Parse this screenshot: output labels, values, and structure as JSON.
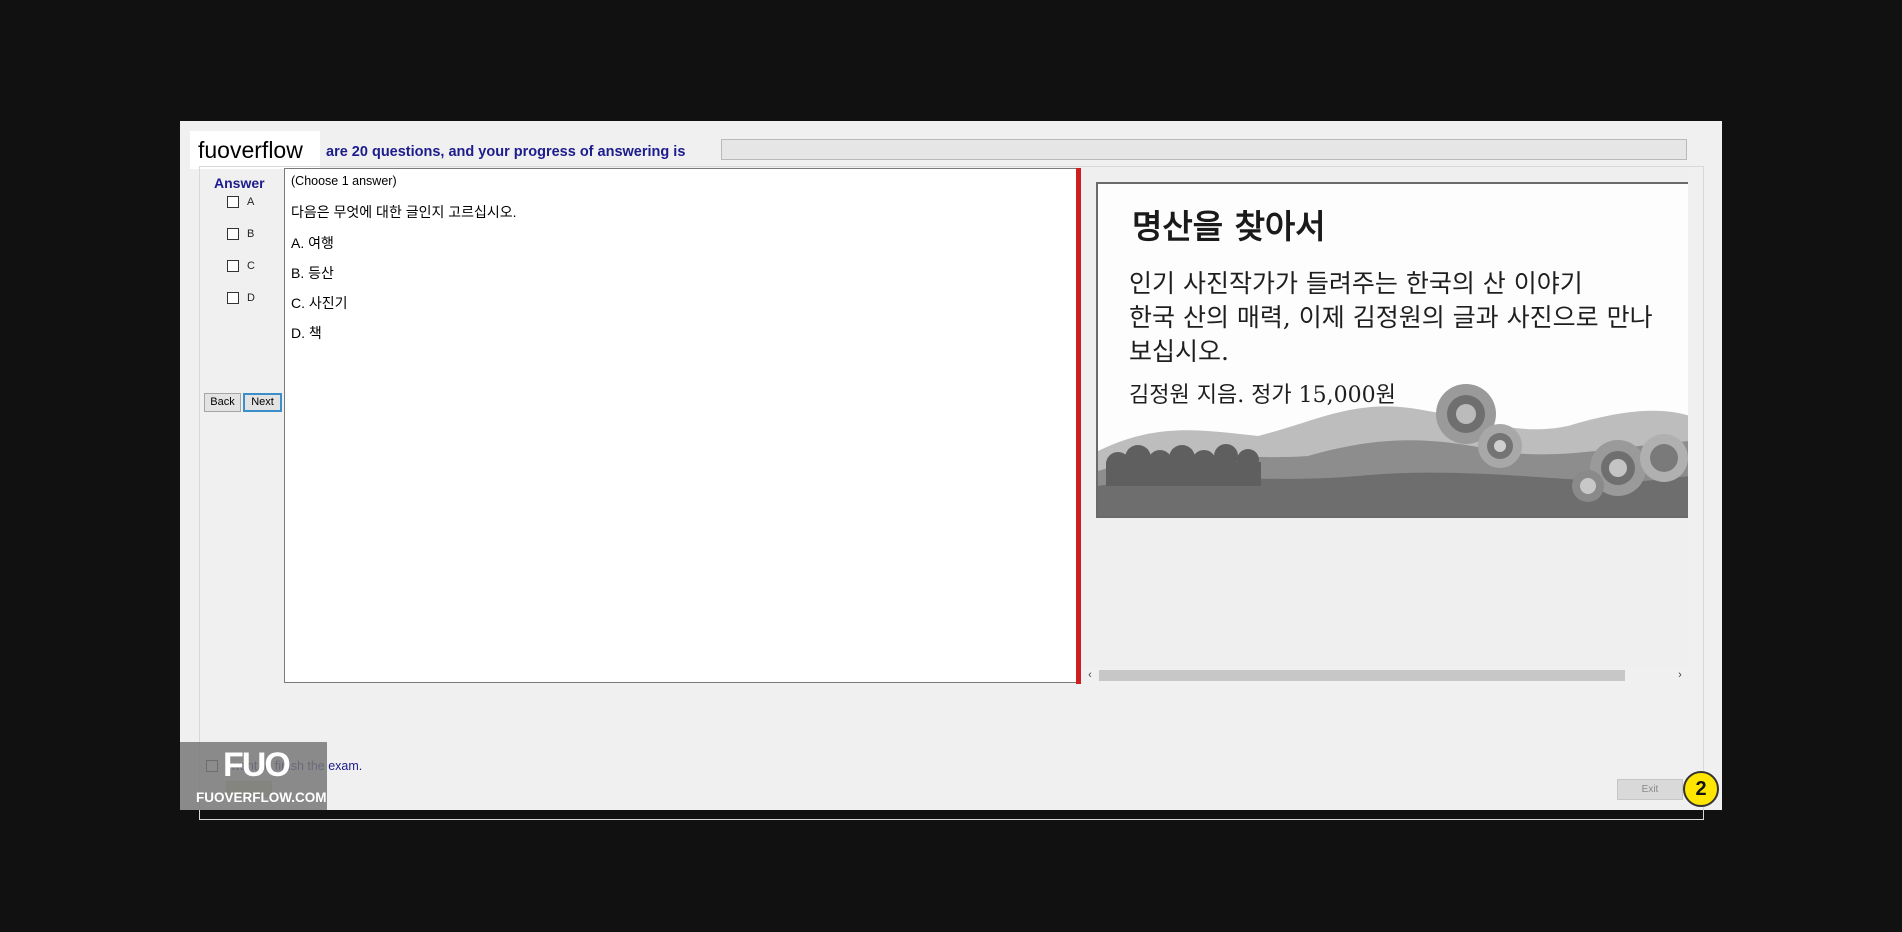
{
  "site_label": "fuoverflow",
  "header": {
    "progress_text": "are 20 questions, and your progress of answering is",
    "progress_fraction": 0
  },
  "answer_panel": {
    "title": "Answer",
    "options": [
      "A",
      "B",
      "C",
      "D"
    ],
    "back_label": "Back",
    "next_label": "Next"
  },
  "question": {
    "hint": "(Choose 1 answer)",
    "stem": "다음은 무엇에 대한 글인지 고르십시오.",
    "options": [
      "A.  여행",
      "B.  등산",
      "C.  사진기",
      "D.  책"
    ]
  },
  "image": {
    "title": "명산을 찾아서",
    "line1": "인기 사진작가가 들려주는 한국의 산 이야기",
    "line2": "한국 산의 매력, 이제 김정원의 글과 사진으로 만나",
    "line3": "보십시오.",
    "line4": "김정원 지음. 정가 15,000원"
  },
  "footer": {
    "finish_text": "I want to finish the exam.",
    "exit_label": "Exit",
    "badge_number": "2"
  },
  "logo": {
    "mark": "FUO",
    "text": "FUOVERFLOW.COM"
  },
  "colors": {
    "accent_red": "#cc1f1f",
    "label_blue": "#1c1c8c",
    "badge_yellow": "#ffe600"
  }
}
